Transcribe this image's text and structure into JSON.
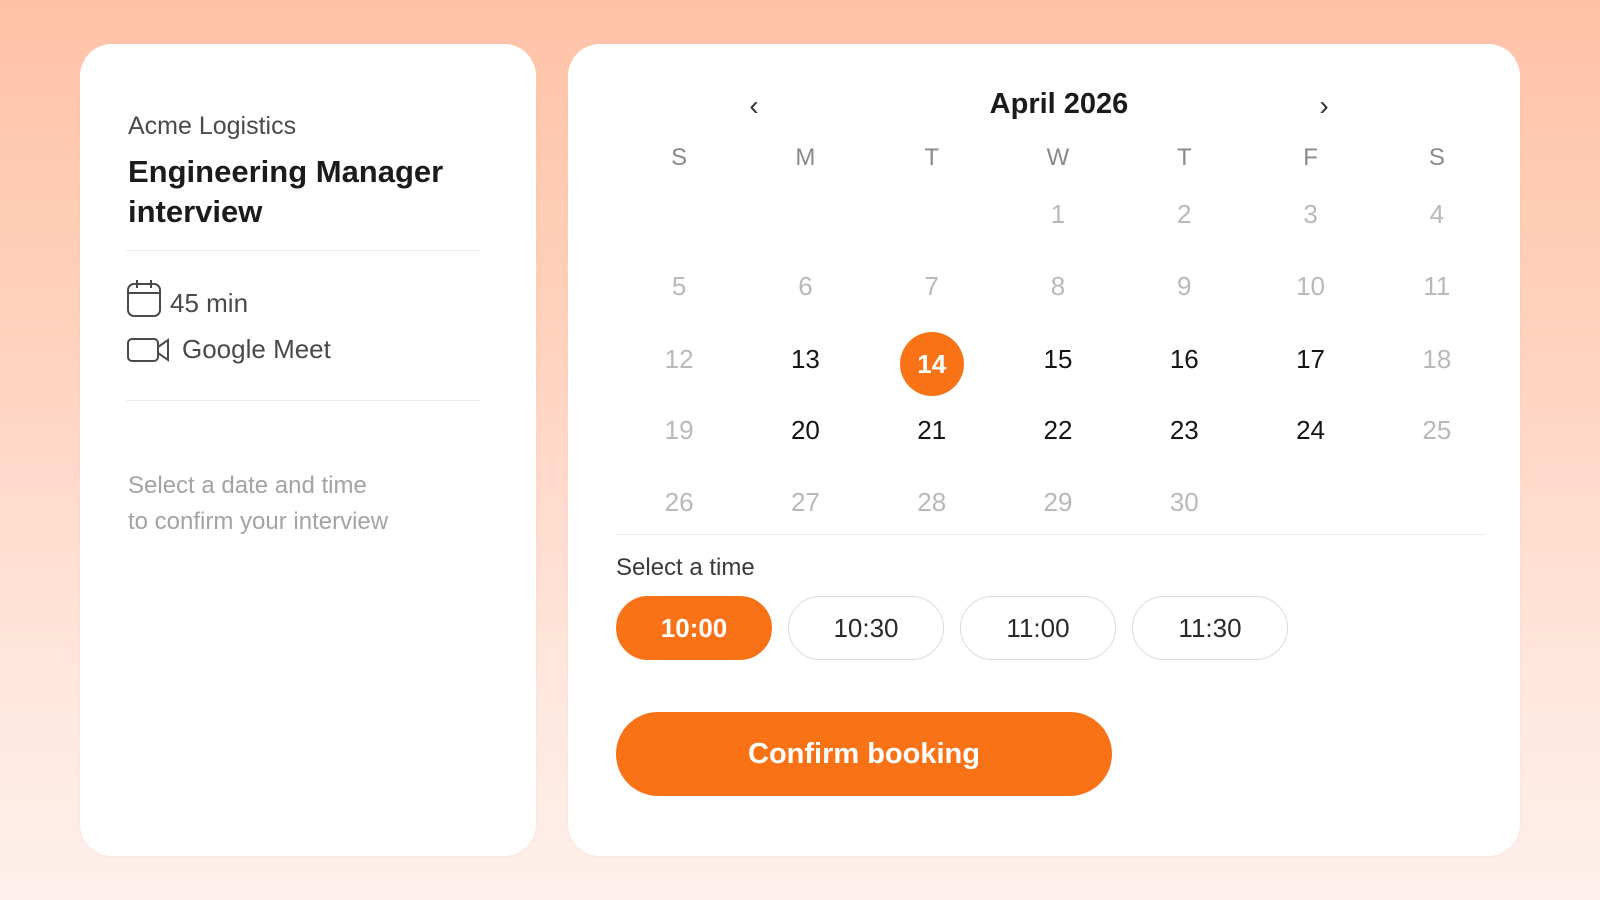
{
  "summary": {
    "company": "Acme Logistics",
    "title": "Engineering Manager interview",
    "duration": "45 min",
    "location": "Google Meet",
    "hint_line1": "Select a date and time",
    "hint_line2": "to confirm your interview"
  },
  "calendar": {
    "month_label": "April 2026",
    "prev_icon": "chevron-left-icon",
    "next_icon": "chevron-right-icon",
    "weekdays": [
      "S",
      "M",
      "T",
      "W",
      "T",
      "F",
      "S"
    ],
    "weeks": [
      [
        "",
        "",
        "",
        "1",
        "2",
        "3",
        "4"
      ],
      [
        "5",
        "6",
        "7",
        "8",
        "9",
        "10",
        "11"
      ],
      [
        "12",
        "13",
        "14",
        "15",
        "16",
        "17",
        "18"
      ],
      [
        "19",
        "20",
        "21",
        "22",
        "23",
        "24",
        "25"
      ],
      [
        "26",
        "27",
        "28",
        "29",
        "30",
        "",
        ""
      ]
    ],
    "available_days": [
      "13",
      "14",
      "15",
      "16",
      "17",
      "20",
      "21",
      "22",
      "23",
      "24"
    ],
    "selected_day": "14"
  },
  "time": {
    "label": "Select a time",
    "slots": [
      "10:00",
      "10:30",
      "11:00",
      "11:30"
    ],
    "selected": "10:00"
  },
  "confirm_label": "Confirm booking",
  "colors": {
    "accent": "#f97316",
    "text_primary": "#1b1b1b",
    "text_muted": "#b9b9b9"
  }
}
